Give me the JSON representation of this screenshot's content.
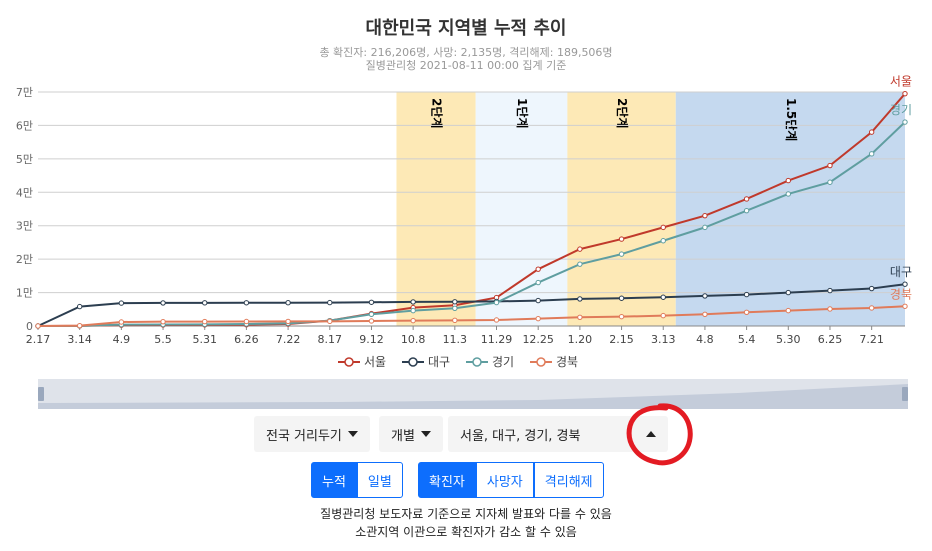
{
  "chart_data": {
    "type": "line",
    "title": "대한민국 지역별 누적 추이",
    "subtitle_line1": "총 확진자: 216,206명, 사망: 2,135명, 격리해제: 189,506명",
    "subtitle_line2": "질병관리청 2021-08-11 00:00 집계 기준",
    "x_ticks": [
      "2.17",
      "3.14",
      "4.9",
      "5.5",
      "5.31",
      "6.26",
      "7.22",
      "8.17",
      "9.12",
      "10.8",
      "11.3",
      "11.29",
      "12.25",
      "1.20",
      "2.15",
      "3.13",
      "4.8",
      "5.4",
      "5.30",
      "6.25",
      "7.21"
    ],
    "y_ticks": [
      "0",
      "1만",
      "2만",
      "3만",
      "4만",
      "5만",
      "6만",
      "7만"
    ],
    "ylim": [
      0,
      70000
    ],
    "grid": true,
    "legend_position": "bottom",
    "bands": [
      {
        "start": 8.6,
        "end": 10.5,
        "color": "#fde9b6",
        "label": "2단계"
      },
      {
        "start": 10.5,
        "end": 12.7,
        "color": "#eef6fd",
        "label": "1단계"
      },
      {
        "start": 12.7,
        "end": 15.3,
        "color": "#fde9b6",
        "label": "2단계"
      },
      {
        "start": 15.3,
        "end": 20.8,
        "color": "#c5d9ef",
        "label": "1.5단계"
      }
    ],
    "series": [
      {
        "name": "서울",
        "color": "#c0392b",
        "values": [
          0,
          20,
          250,
          300,
          350,
          400,
          600,
          1600,
          3700,
          5500,
          6200,
          8500,
          17000,
          23000,
          26000,
          29500,
          33000,
          38000,
          43500,
          48000,
          58000,
          69500
        ]
      },
      {
        "name": "대구",
        "color": "#2c3e50",
        "values": [
          0,
          5800,
          6850,
          6900,
          6930,
          6950,
          6970,
          7000,
          7100,
          7200,
          7250,
          7350,
          7600,
          8100,
          8300,
          8600,
          9000,
          9400,
          10000,
          10600,
          11200,
          12500
        ]
      },
      {
        "name": "경기",
        "color": "#5f9ea0",
        "values": [
          0,
          20,
          400,
          450,
          500,
          600,
          800,
          1600,
          3500,
          4600,
          5300,
          7000,
          13000,
          18500,
          21500,
          25500,
          29500,
          34500,
          39500,
          43000,
          51500,
          61000
        ]
      },
      {
        "name": "경북",
        "color": "#e07b5a",
        "values": [
          0,
          100,
          1200,
          1300,
          1320,
          1350,
          1370,
          1400,
          1500,
          1600,
          1700,
          1800,
          2200,
          2600,
          2800,
          3100,
          3500,
          4100,
          4600,
          5100,
          5400,
          5900
        ]
      }
    ]
  },
  "controls": {
    "distancing_label": "전국 거리두기",
    "mode_label": "개별",
    "region_select": "서울, 대구, 경기, 경북",
    "group1": [
      "누적",
      "일별"
    ],
    "group2": [
      "확진자",
      "사망자",
      "격리해제"
    ]
  },
  "notes": [
    "질병관리청 보도자료 기준으로 지자체 발표와 다를 수 있음",
    "소관지역 이관으로 확진자가 감소 할 수 있음"
  ],
  "annotation_color": "#e31b23"
}
